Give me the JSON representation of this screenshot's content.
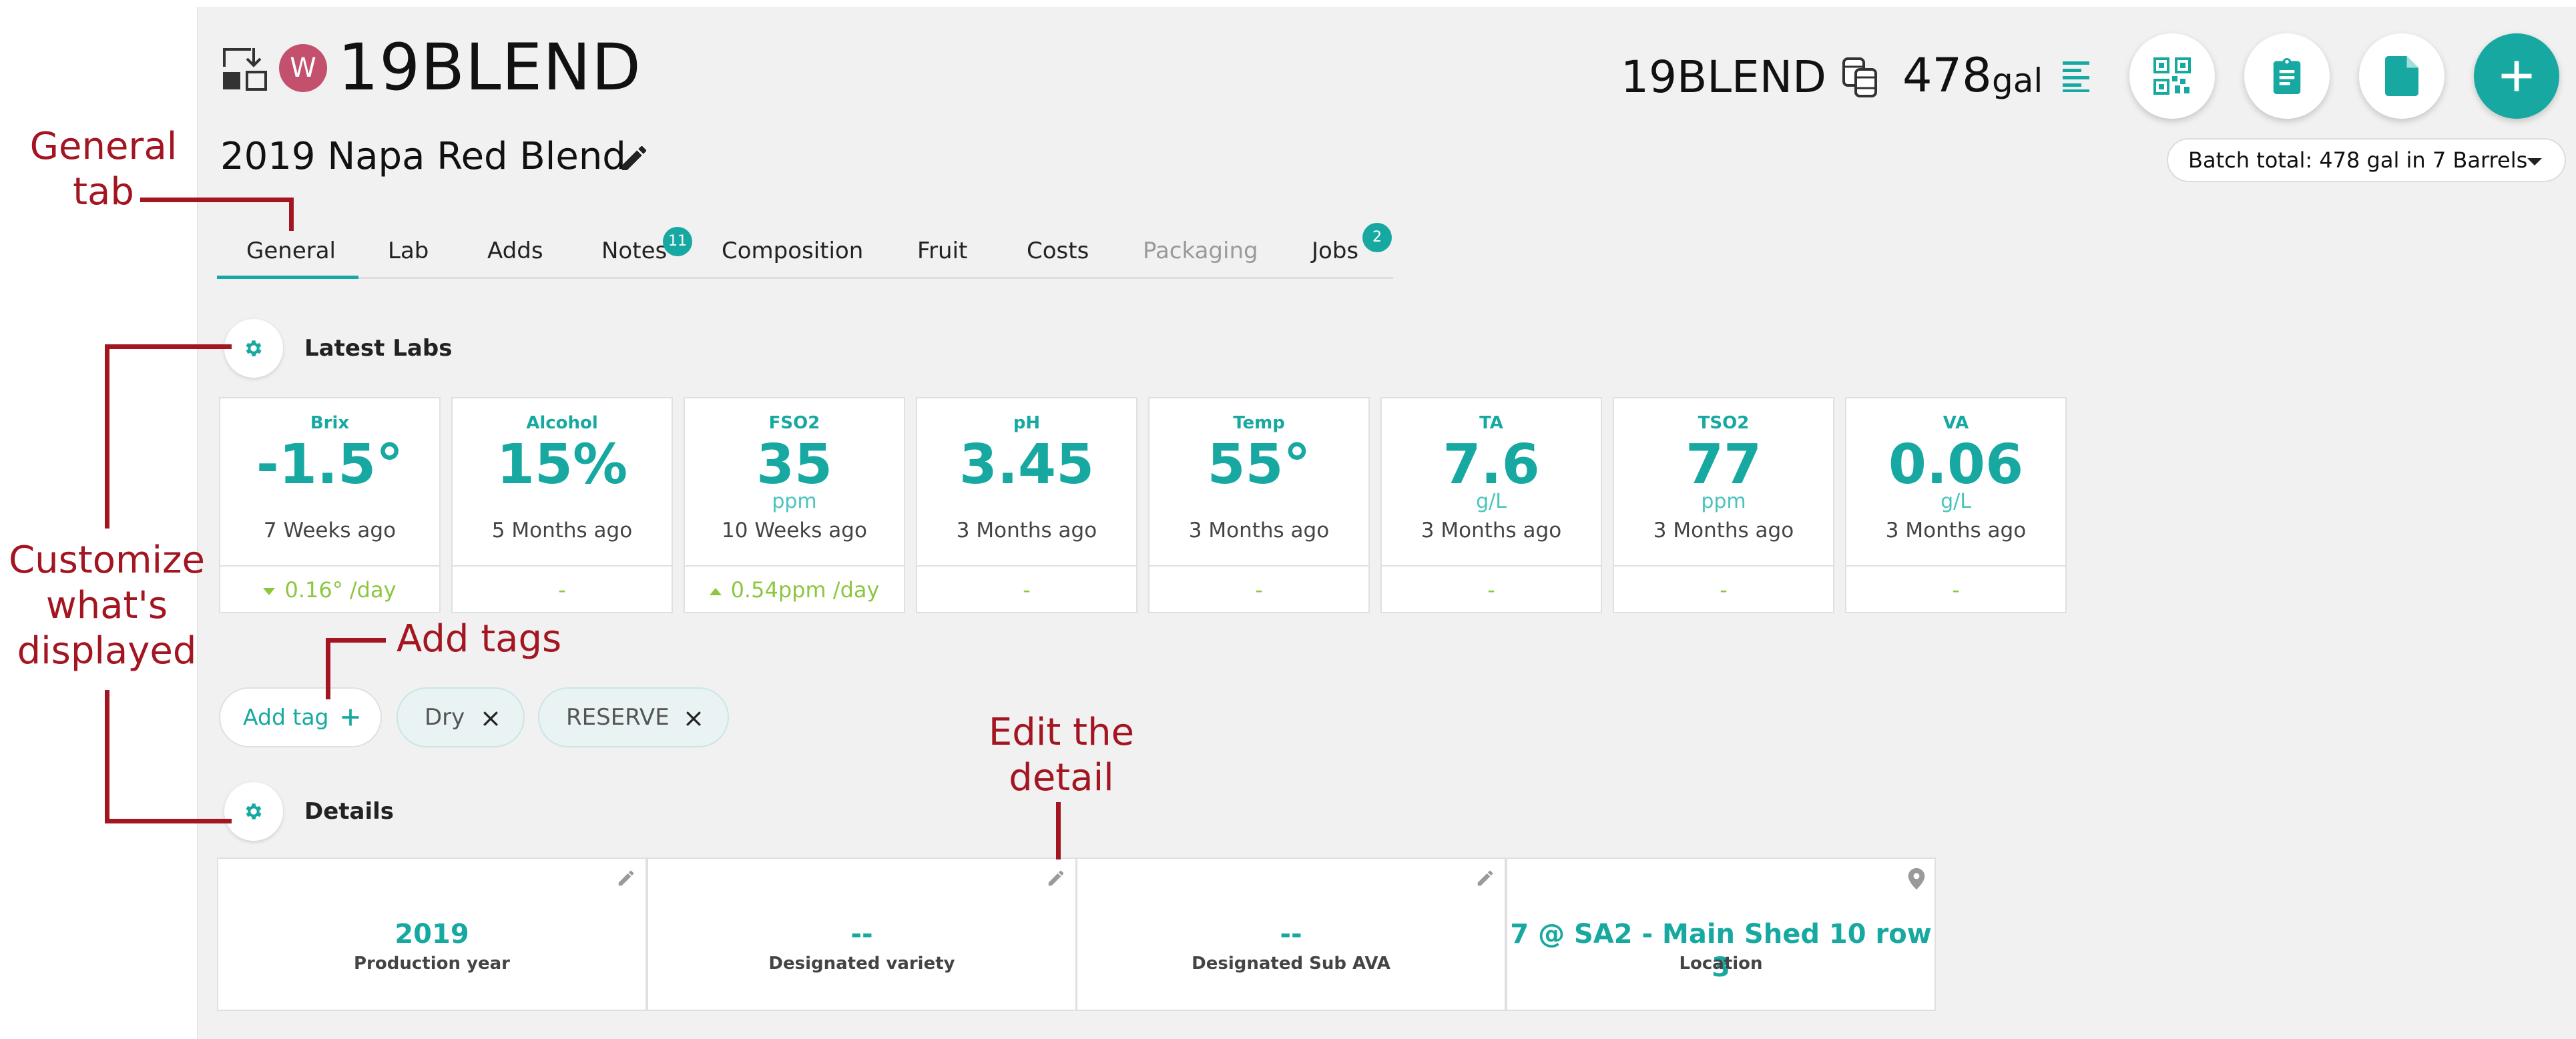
{
  "header": {
    "brand": "19BLEND",
    "avatar_letter": "W",
    "title": "2019 Napa Red Blend",
    "right_name": "19BLEND",
    "volume": "478",
    "volume_unit": "gal",
    "batch_total": "Batch total: 478 gal in 7 Barrels"
  },
  "tabs": [
    {
      "label": "General",
      "active": true
    },
    {
      "label": "Lab"
    },
    {
      "label": "Adds"
    },
    {
      "label": "Notes",
      "badge": "11"
    },
    {
      "label": "Composition"
    },
    {
      "label": "Fruit"
    },
    {
      "label": "Costs"
    },
    {
      "label": "Packaging",
      "disabled": true
    },
    {
      "label": "Jobs",
      "badge": "2"
    }
  ],
  "latest_labs": {
    "title": "Latest Labs",
    "cards": [
      {
        "name": "Brix",
        "value": "-1.5°",
        "unit": "",
        "age": "7 Weeks ago",
        "trend": "0.16° /day",
        "trend_dir": "down"
      },
      {
        "name": "Alcohol",
        "value": "15%",
        "unit": "",
        "age": "5 Months ago",
        "trend": "-"
      },
      {
        "name": "FSO2",
        "value": "35",
        "unit": "ppm",
        "age": "10 Weeks ago",
        "trend": "0.54ppm /day",
        "trend_dir": "up"
      },
      {
        "name": "pH",
        "value": "3.45",
        "unit": "",
        "age": "3 Months ago",
        "trend": "-"
      },
      {
        "name": "Temp",
        "value": "55°",
        "unit": "",
        "age": "3 Months ago",
        "trend": "-"
      },
      {
        "name": "TA",
        "value": "7.6",
        "unit": "g/L",
        "age": "3 Months ago",
        "trend": "-"
      },
      {
        "name": "TSO2",
        "value": "77",
        "unit": "ppm",
        "age": "3 Months ago",
        "trend": "-"
      },
      {
        "name": "VA",
        "value": "0.06",
        "unit": "g/L",
        "age": "3 Months ago",
        "trend": "-"
      }
    ]
  },
  "tags": {
    "add_label": "Add tag",
    "items": [
      "Dry",
      "RESERVE"
    ]
  },
  "details": {
    "title": "Details",
    "cards": [
      {
        "value": "2019",
        "label": "Production year",
        "icon": "pencil-icon"
      },
      {
        "value": "--",
        "label": "Designated variety",
        "icon": "pencil-icon"
      },
      {
        "value": "--",
        "label": "Designated Sub AVA",
        "icon": "pencil-icon"
      },
      {
        "value": "7 @ SA2 - Main Shed 10 row 3",
        "label": "Location",
        "icon": "map-pin-icon"
      }
    ]
  },
  "annotations": {
    "general_tab": "General tab",
    "customize": "Customize what's displayed",
    "add_tags": "Add tags",
    "edit_detail": "Edit the detail"
  },
  "colors": {
    "accent": "#17a9a1",
    "annotation": "#a31521",
    "trend": "#8dc63f",
    "avatar": "#c3506c"
  }
}
